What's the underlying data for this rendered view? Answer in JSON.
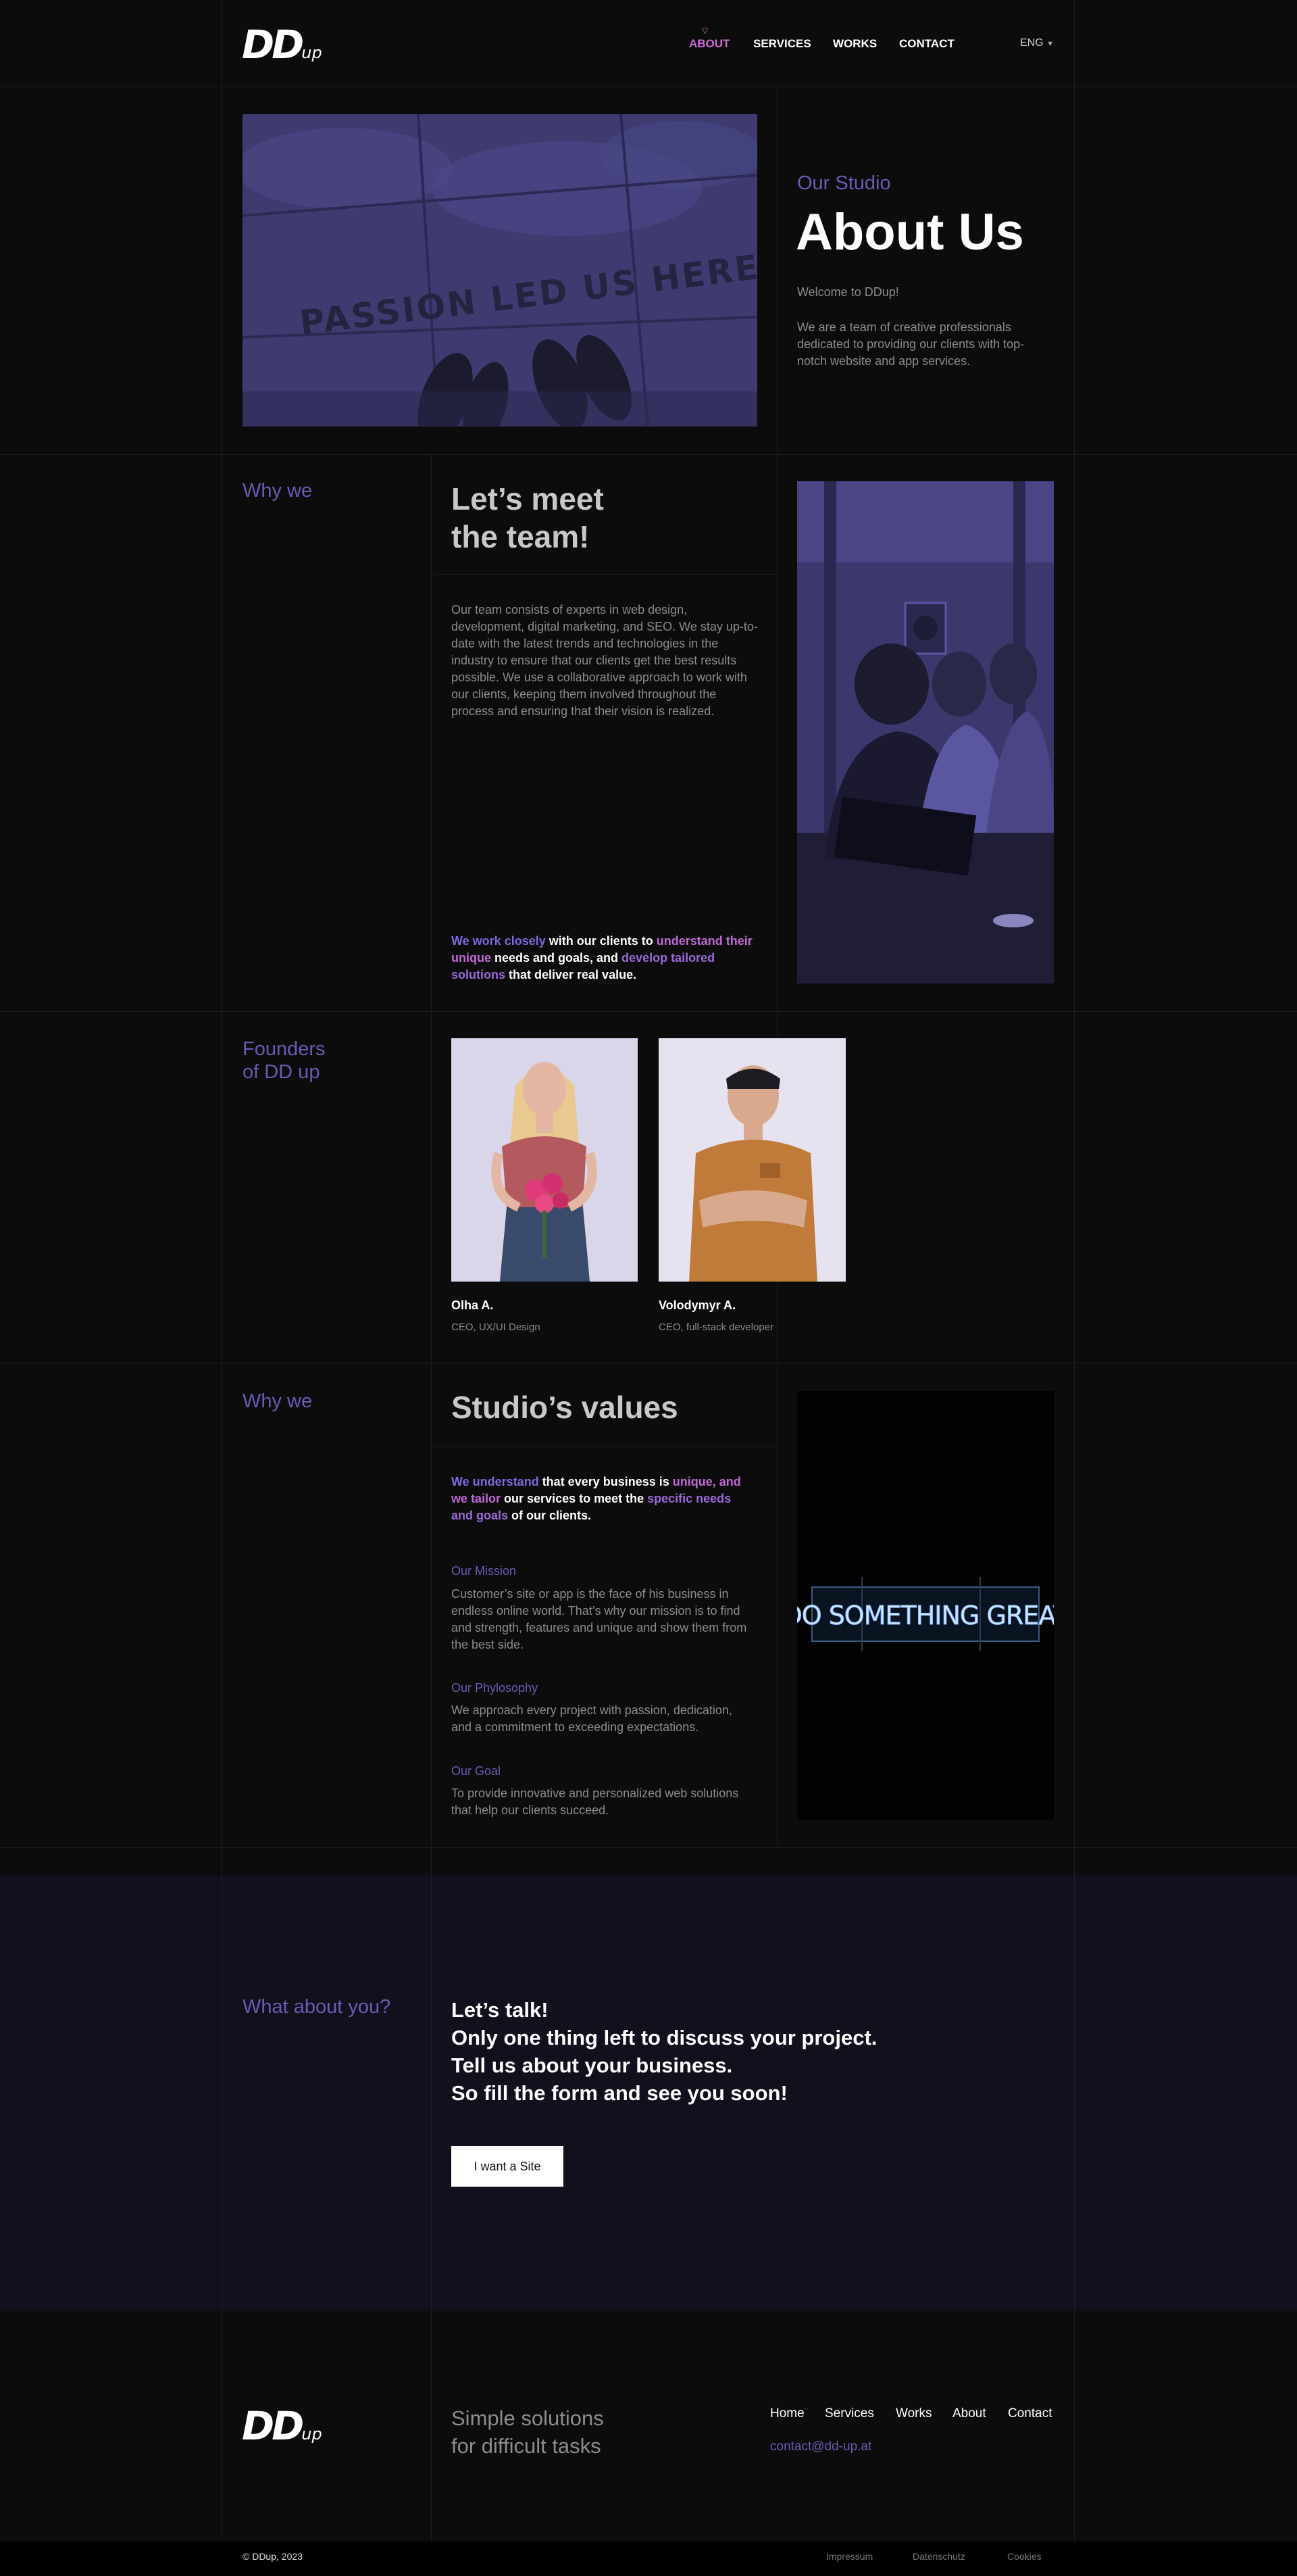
{
  "nav": {
    "items": [
      "About",
      "Services",
      "Works",
      "Contact"
    ],
    "active_index": 0,
    "lang": "ENG"
  },
  "logo": {
    "main": "DD",
    "sub": "up"
  },
  "hero": {
    "eyebrow": "Our Studio",
    "title": "About Us",
    "welcome": "Welcome to DDup!",
    "description": "We are a team of creative professionals dedicated to providing our clients with top-notch website and app services.",
    "image_text": "PASSION LED US HERE"
  },
  "team": {
    "label": "Why we",
    "title_line1": "Let’s meet",
    "title_line2": "the team!",
    "body": "Our team consists of experts in web design, development, digital marketing, and SEO. We stay up-to-date with the latest trends and technologies in the industry to ensure that our clients get the best results possible. We use a collaborative approach to work with our clients, keeping them involved throughout the process and ensuring that their vision is realized.",
    "highlight_parts": [
      {
        "text": "We work closely",
        "color": "#7b6be0"
      },
      {
        "text": " with our clients to ",
        "color": "#ffffff"
      },
      {
        "text": "understand their unique",
        "color": "#c06ad8"
      },
      {
        "text": " needs and goals, and ",
        "color": "#ffffff"
      },
      {
        "text": "develop tailored solutions",
        "color": "#9b6ad8"
      },
      {
        "text": " that deliver real value.",
        "color": "#ffffff"
      }
    ]
  },
  "founders": {
    "label_line1": "Founders",
    "label_line2": "of DD up",
    "people": [
      {
        "name": "Olha A.",
        "role": "CEO, UX/UI Design"
      },
      {
        "name": "Volodymyr A.",
        "role": "CEO, full-stack developer"
      }
    ]
  },
  "values": {
    "label": "Why we",
    "title": "Studio’s values",
    "highlight_parts": [
      {
        "text": "We understand",
        "color": "#7b6be0"
      },
      {
        "text": " that every business is ",
        "color": "#ffffff"
      },
      {
        "text": "unique, and we tailor",
        "color": "#c06ad8"
      },
      {
        "text": " our services to meet the ",
        "color": "#ffffff"
      },
      {
        "text": "specific needs and goals",
        "color": "#9b6ad8"
      },
      {
        "text": " of our clients.",
        "color": "#ffffff"
      }
    ],
    "mission_title": "Our Mission",
    "mission_body": "Customer’s site or app is the face of his business in endless online world. That’s why our mission is to find and strength, features and unique and show them from the best side.",
    "philosophy_title": "Our Phylosophy",
    "philosophy_body": "We approach every project with passion, dedication, and a commitment to exceeding expectations.",
    "goal_title": "Our Goal",
    "goal_body": "To provide innovative and personalized web solutions that help our clients succeed.",
    "neon_text": "DO SOMETHING GREAT"
  },
  "cta": {
    "label": "What about you?",
    "lines": [
      "Let’s talk!",
      "Only one thing left to discuss your project.",
      "Tell us about your business.",
      "So fill the form and see you soon!"
    ],
    "button": "I want a Site"
  },
  "footer": {
    "tagline_line1": "Simple solutions",
    "tagline_line2": "for difficult tasks",
    "links": [
      "Home",
      "Services",
      "Works",
      "About",
      "Contact"
    ],
    "email": "contact@dd-up.at",
    "copyright": "© DDup, 2023",
    "bottom_links": [
      "Impressum",
      "Datenschutz",
      "Cookies"
    ]
  },
  "colors": {
    "background": "#0c0c0c",
    "accent": "#6a5bb5",
    "nav_active": "#d067d6",
    "cta_background": "#11111e",
    "photo_tint": "#3b3770"
  }
}
